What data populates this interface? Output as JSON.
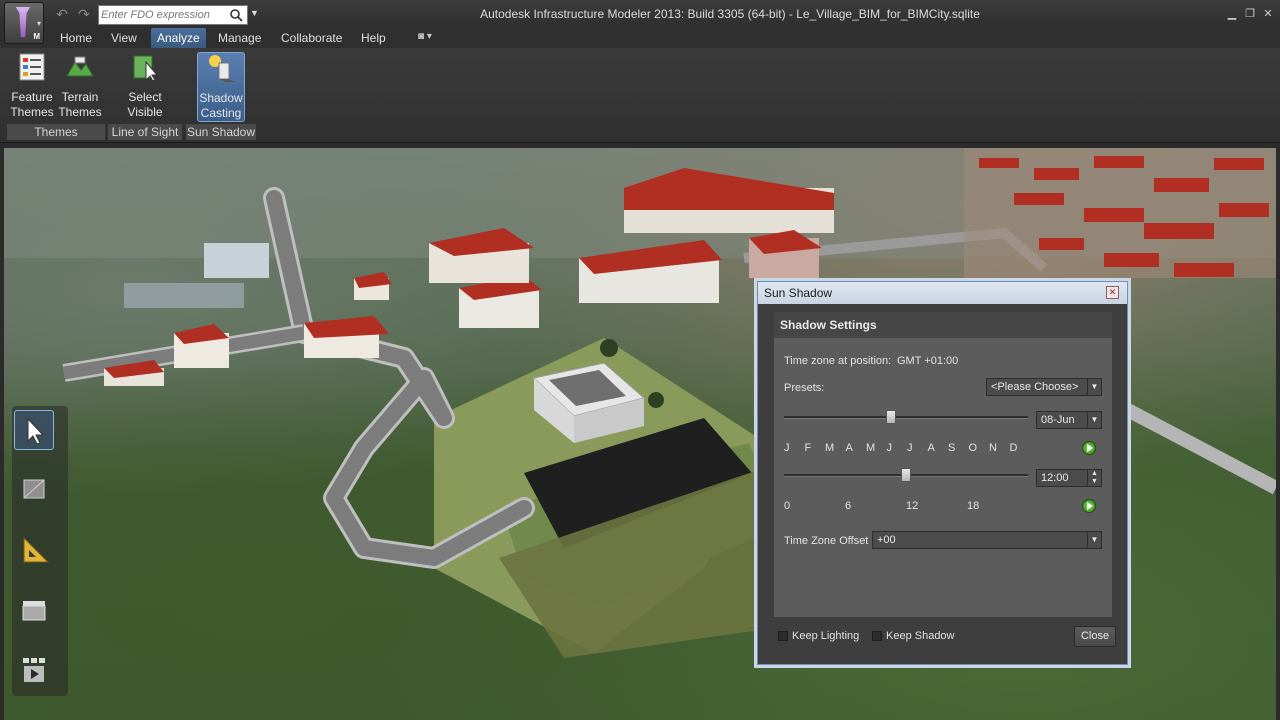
{
  "window": {
    "title": "Autodesk Infrastructure Modeler 2013: Build 3305 (64-bit) - Le_Village_BIM_for_BIMCity.sqlite",
    "app_letter": "M"
  },
  "quick_access": {
    "fdo_placeholder": "Enter FDO expression"
  },
  "tabs": [
    {
      "label": "Home"
    },
    {
      "label": "View"
    },
    {
      "label": "Analyze"
    },
    {
      "label": "Manage"
    },
    {
      "label": "Collaborate"
    },
    {
      "label": "Help"
    }
  ],
  "ribbon": {
    "buttons": [
      {
        "label": "Feature\nThemes",
        "icon": "feature-themes-icon"
      },
      {
        "label": "Terrain\nThemes",
        "icon": "terrain-themes-icon"
      },
      {
        "label": "Select\nVisible",
        "icon": "select-visible-icon"
      },
      {
        "label": "Shadow\nCasting",
        "icon": "shadow-casting-icon"
      }
    ],
    "panels": [
      {
        "label": "Themes"
      },
      {
        "label": "Line of Sight"
      },
      {
        "label": "Sun Shadow"
      }
    ]
  },
  "dialog": {
    "title": "Sun Shadow",
    "section_title": "Shadow Settings",
    "time_zone_label": "Time zone at position:",
    "time_zone_value": "GMT +01:00",
    "presets_label": "Presets:",
    "presets_value": "<Please Choose>",
    "date_value": "08-Jun",
    "months": [
      "J",
      "F",
      "M",
      "A",
      "M",
      "J",
      "J",
      "A",
      "S",
      "O",
      "N",
      "D"
    ],
    "time_value": "12:00",
    "hour_ticks": [
      "0",
      "6",
      "12",
      "18"
    ],
    "tz_offset_label": "Time Zone Offset",
    "tz_offset_value": "+00",
    "keep_lighting_label": "Keep Lighting",
    "keep_shadow_label": "Keep Shadow",
    "close_label": "Close",
    "date_slider_fraction": 0.44,
    "time_slider_fraction": 0.5
  },
  "colors": {
    "accent": "#4a6f9a",
    "roof_red": "#b02e22",
    "play_green": "#3fa82a"
  }
}
